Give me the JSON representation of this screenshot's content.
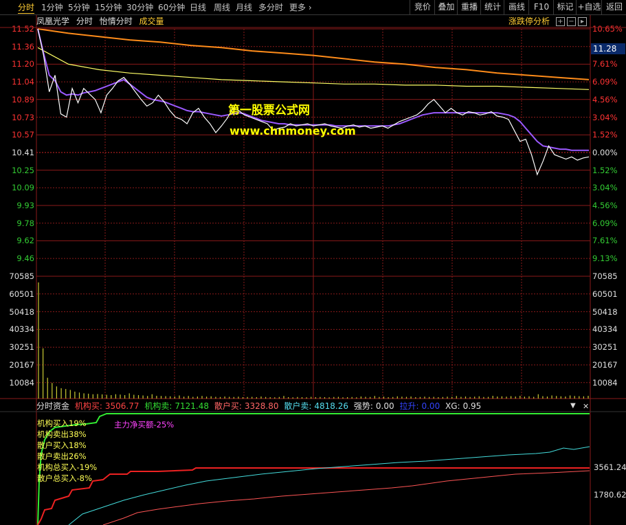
{
  "toolbar": {
    "periods": [
      "分时",
      "1分钟",
      "5分钟",
      "15分钟",
      "30分钟",
      "60分钟",
      "日线",
      "周线",
      "月线",
      "多分时",
      "更多"
    ],
    "buttons": [
      "竞价",
      "叠加",
      "重播",
      "统计",
      "画线",
      "F10",
      "标记",
      "+自选",
      "返回"
    ]
  },
  "info": {
    "stock_name": "凤凰光学",
    "mode": "分时",
    "formula": "怡情分时",
    "indicator": "成交量",
    "limit_analysis": "涨跌停分析"
  },
  "price_axis": {
    "left": [
      "11.52",
      "11.36",
      "11.20",
      "11.04",
      "10.89",
      "10.73",
      "10.57",
      "10.41",
      "10.25",
      "10.09",
      "9.93",
      "9.78",
      "9.62",
      "9.46"
    ],
    "right": [
      "10.65%",
      "9.13%",
      "7.61%",
      "6.09%",
      "4.56%",
      "3.04%",
      "1.52%",
      "0.00%",
      "1.52%",
      "3.04%",
      "4.56%",
      "6.09%",
      "7.61%",
      "9.13%"
    ],
    "current_price": "11.28",
    "prev_close": 10.41
  },
  "volume_axis": [
    "70585",
    "60501",
    "50418",
    "40334",
    "30251",
    "20167",
    "10084"
  ],
  "watermark": {
    "line1": "第一股票公式网",
    "line2": "www.chnmoney.com"
  },
  "indicator_panel": {
    "name": "分时资金",
    "inst_buy_label": "机构买:",
    "inst_buy": "3506.77",
    "inst_sell_label": "机构卖:",
    "inst_sell": "7121.48",
    "retail_buy_label": "散户买:",
    "retail_buy": "3328.80",
    "retail_sell_label": "散户卖:",
    "retail_sell": "4818.26",
    "strength_label": "强势:",
    "strength": "0.00",
    "pull_label": "拉升:",
    "pull": "0.00",
    "xg_label": "XG:",
    "xg": "0.95",
    "legend": [
      "机构买入19%",
      "机构卖出38%",
      "散户买入18%",
      "散户卖出26%",
      "机构总买入-19%",
      "散户总买入-8%"
    ],
    "main_net": "主力净买额-25%",
    "axis": [
      "3561.24",
      "1780.62"
    ]
  },
  "colors": {
    "grid": "#8b1a1a",
    "up": "#ff3333",
    "down": "#33cc33",
    "price_line": "#ffffff",
    "avg_line": "#9b59ff",
    "orange": "#ff8c1a",
    "yellow": "#ffff66"
  },
  "chart_data": {
    "type": "line",
    "series": [
      {
        "values": [
          11.52,
          11.28,
          10.95,
          11.1,
          10.75,
          10.72,
          10.98,
          10.85,
          10.98,
          10.93,
          10.88,
          10.76,
          10.92,
          10.98,
          11.05,
          11.08,
          11.02,
          10.95,
          10.88,
          10.82,
          10.85,
          10.92,
          10.86,
          10.78,
          10.72,
          10.7,
          10.66,
          10.76,
          10.8,
          10.72,
          10.66,
          10.58,
          10.64,
          10.71,
          10.8,
          10.78,
          10.74,
          10.72,
          10.7,
          10.68,
          10.66,
          10.6,
          10.62,
          10.63,
          10.66,
          10.64,
          10.65,
          10.66,
          10.64,
          10.65,
          10.66,
          10.64,
          10.63,
          10.62,
          10.64,
          10.65,
          10.63,
          10.64,
          10.62,
          10.63,
          10.64,
          10.62,
          10.65,
          10.68,
          10.7,
          10.72,
          10.74,
          10.78,
          10.84,
          10.88,
          10.82,
          10.76,
          10.8,
          10.76,
          10.74,
          10.77,
          10.76,
          10.74,
          10.75,
          10.77,
          10.73,
          10.72,
          10.7,
          10.6,
          10.5,
          10.52,
          10.38,
          10.2,
          10.32,
          10.46,
          10.38,
          10.36,
          10.34,
          10.36,
          10.33,
          10.35,
          10.36
        ]
      },
      {
        "values": [
          11.52,
          11.3,
          11.1,
          11.05,
          10.95,
          10.92,
          10.93,
          10.92,
          10.94,
          10.95,
          10.96,
          10.98,
          11.0,
          11.02,
          11.04,
          11.06,
          11.02,
          10.98,
          10.94,
          10.9,
          10.88,
          10.87,
          10.86,
          10.84,
          10.82,
          10.8,
          10.78,
          10.77,
          10.77,
          10.76,
          10.75,
          10.74,
          10.73,
          10.74,
          10.75,
          10.76,
          10.75,
          10.73,
          10.71,
          10.69,
          10.68,
          10.67,
          10.66,
          10.66,
          10.65,
          10.65,
          10.65,
          10.65,
          10.65,
          10.65,
          10.65,
          10.65,
          10.64,
          10.64,
          10.64,
          10.64,
          10.64,
          10.64,
          10.64,
          10.64,
          10.64,
          10.64,
          10.65,
          10.66,
          10.68,
          10.7,
          10.72,
          10.74,
          10.75,
          10.76,
          10.76,
          10.76,
          10.76,
          10.76,
          10.76,
          10.76,
          10.76,
          10.76,
          10.76,
          10.76,
          10.76,
          10.75,
          10.74,
          10.72,
          10.68,
          10.62,
          10.56,
          10.5,
          10.46,
          10.45,
          10.44,
          10.43,
          10.43,
          10.42,
          10.42,
          10.42,
          10.42
        ]
      },
      {
        "values": [
          11.52,
          11.48,
          11.45,
          11.42,
          11.4,
          11.37,
          11.35,
          11.32,
          11.3,
          11.28,
          11.25,
          11.22,
          11.2,
          11.17,
          11.15,
          11.12,
          11.1,
          11.08,
          11.06
        ]
      },
      {
        "values": [
          11.35,
          11.2,
          11.15,
          11.12,
          11.1,
          11.08,
          11.06,
          11.05,
          11.04,
          11.03,
          11.02,
          11.02,
          11.01,
          11.01,
          11.0,
          11.0,
          10.99,
          10.98,
          10.97
        ]
      },
      {
        "values": [
          67000,
          29000,
          12000,
          9000,
          7000,
          6000,
          5500,
          5000,
          4000,
          3500,
          3000,
          2800,
          2500,
          2600,
          2400,
          2200,
          2000,
          2500,
          2300,
          2000,
          3000,
          2200,
          2000,
          1800,
          1500,
          2500,
          1600,
          1500,
          1400,
          1300,
          1200,
          1800,
          1100,
          1500,
          1000,
          1200,
          1500,
          1100,
          1300,
          1000,
          900,
          1200,
          1000,
          900,
          1100,
          800,
          900,
          1000,
          800,
          1200,
          900,
          800,
          700,
          900,
          1500,
          800,
          700,
          900,
          800,
          700,
          1000,
          800,
          900,
          800,
          700,
          900,
          1000,
          700,
          800,
          900,
          700,
          1200,
          1000,
          900,
          1500,
          900,
          1100,
          800,
          900,
          1300,
          1100,
          1000,
          1200,
          800,
          900,
          1100,
          900,
          1000,
          800,
          900,
          1100,
          1000,
          1500,
          1000,
          1200,
          900,
          1100,
          1300,
          900,
          1000,
          1600,
          1200,
          1300,
          1100,
          1400,
          1200,
          1600,
          1100,
          1300,
          1000,
          2500,
          1400,
          1200,
          1800,
          1500,
          1300,
          1200,
          1800,
          1500,
          1400,
          1300,
          1600
        ]
      }
    ]
  }
}
